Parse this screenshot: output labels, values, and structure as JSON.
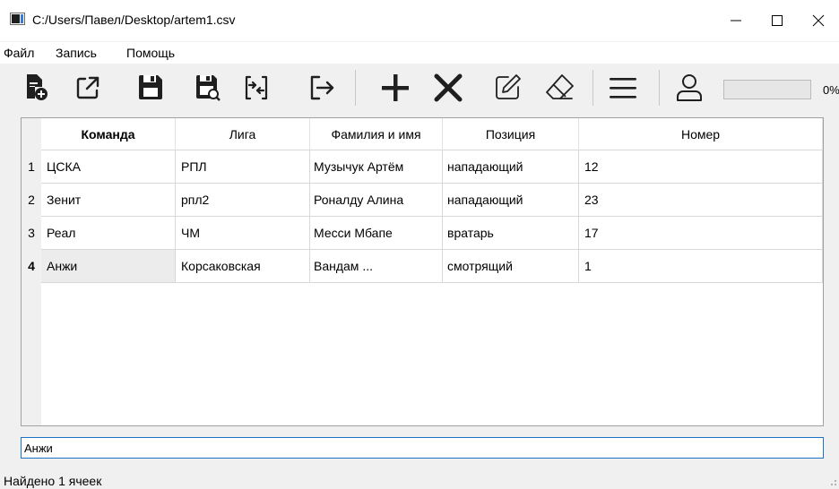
{
  "window": {
    "title": "C:/Users/Павел/Desktop/artem1.csv"
  },
  "menu": [
    "Файл",
    "Запись",
    "Помощь"
  ],
  "toolbar": {
    "icons": [
      "new-file-plus-icon",
      "open-external-icon",
      "save-icon",
      "save-as-icon",
      "merge-arrows-icon",
      "exit-arrow-icon",
      "add-plus-icon",
      "delete-x-icon",
      "edit-pencil-icon",
      "eraser-icon",
      "menu-lines-icon",
      "user-icon"
    ],
    "progress": {
      "value": 0,
      "label": "0%"
    }
  },
  "table": {
    "headers": [
      "Команда",
      "Лига",
      "Фамилия и имя",
      "Позиция",
      "Номер"
    ],
    "rows": [
      {
        "num": "1",
        "cells": [
          "ЦСКА",
          "РПЛ",
          "Музычук Артём",
          "нападающий",
          "12"
        ]
      },
      {
        "num": "2",
        "cells": [
          "Зенит",
          "рпл2",
          "Роналду Алина",
          "нападающий",
          "23"
        ]
      },
      {
        "num": "3",
        "cells": [
          "Реал",
          "ЧМ",
          "Месси Мбапе",
          "вратарь",
          "17"
        ]
      },
      {
        "num": "4",
        "cells": [
          "Анжи",
          "Корсаковская",
          "Вандам ...",
          "смотрящий",
          "1"
        ]
      }
    ]
  },
  "search": {
    "value": "Анжи"
  },
  "status": {
    "text": "Найдено 1 ячеек"
  },
  "colors": {
    "accent": "#1a73c8",
    "selected_bg": "#ececec"
  }
}
